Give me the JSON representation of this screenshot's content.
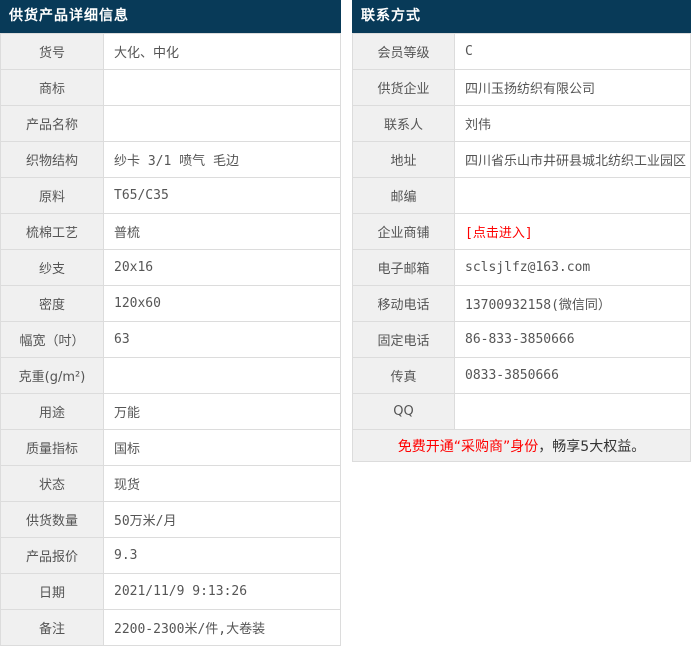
{
  "colors": {
    "header_bg": "#083a58",
    "header_text": "#ffffff",
    "label_bg": "#f0f0f0",
    "border": "#dcdcdc",
    "text": "#555555",
    "accent_red": "#ff0000"
  },
  "product_table": {
    "title": "供货产品详细信息",
    "rows": [
      {
        "label": "货号",
        "value": "大化、中化"
      },
      {
        "label": "商标",
        "value": ""
      },
      {
        "label": "产品名称",
        "value": ""
      },
      {
        "label": "织物结构",
        "value": "纱卡 3/1 喷气 毛边"
      },
      {
        "label": "原料",
        "value": "T65/C35"
      },
      {
        "label": "梳棉工艺",
        "value": "普梳"
      },
      {
        "label": "纱支",
        "value": "20x16"
      },
      {
        "label": "密度",
        "value": "120x60"
      },
      {
        "label": "幅宽（吋）",
        "value": "63"
      },
      {
        "label": "克重(g/m²)",
        "value": ""
      },
      {
        "label": "用途",
        "value": "万能"
      },
      {
        "label": "质量指标",
        "value": "国标"
      },
      {
        "label": "状态",
        "value": "现货"
      },
      {
        "label": "供货数量",
        "value": "50万米/月"
      },
      {
        "label": "产品报价",
        "value": "9.3"
      },
      {
        "label": "日期",
        "value": "2021/11/9 9:13:26"
      },
      {
        "label": "备注",
        "value": "2200-2300米/件,大卷装"
      }
    ]
  },
  "contact_table": {
    "title": "联系方式",
    "rows": [
      {
        "label": "会员等级",
        "value": "C"
      },
      {
        "label": "供货企业",
        "value": "四川玉扬纺织有限公司"
      },
      {
        "label": "联系人",
        "value": "刘伟"
      },
      {
        "label": "地址",
        "value": "四川省乐山市井研县城北纺织工业园区"
      },
      {
        "label": "邮编",
        "value": ""
      },
      {
        "label": "企业商铺",
        "value": "[点击进入]",
        "link": true
      },
      {
        "label": "电子邮箱",
        "value": "sclsjlfz@163.com"
      },
      {
        "label": "移动电话",
        "value": "13700932158(微信同）"
      },
      {
        "label": "固定电话",
        "value": "86-833-3850666"
      },
      {
        "label": "传真",
        "value": "0833-3850666"
      },
      {
        "label": "QQ",
        "value": ""
      }
    ],
    "notice": {
      "red": "免费开通“采购商”身份",
      "dark": "，畅享5大权益。"
    }
  }
}
